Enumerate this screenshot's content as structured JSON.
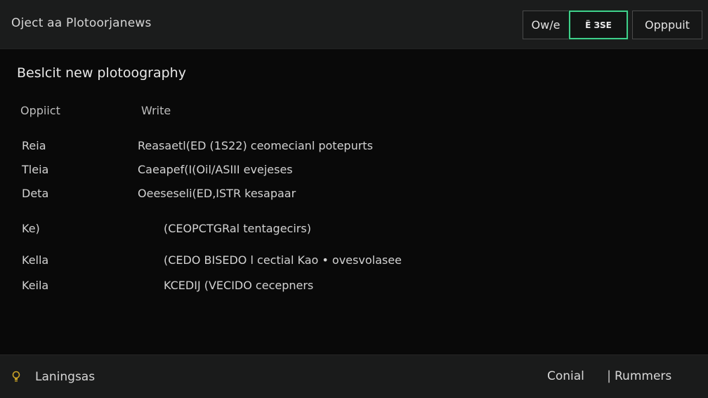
{
  "header": {
    "title": "Oject aa Plotoorjanews",
    "buttons": [
      "Ow/e",
      "Ё ЗSE",
      "Opppuit"
    ]
  },
  "main": {
    "heading": "Beslcit new plotoography",
    "columns": [
      "Oppiict",
      "Write"
    ],
    "rows": [
      {
        "label": "Reia",
        "value": "Reasaetl(ED (1S22)  ceomecianl  potepurts"
      },
      {
        "label": "Tleia",
        "value": "Caeapef(I(Oil/ASIII  evejeses"
      },
      {
        "label": "Deta",
        "value": "Oeeseseli(ED,ISTR  kesapaar"
      },
      {
        "label": "Ke)",
        "value": "(CEOPCTGRal  tentagecirs)"
      },
      {
        "label": "Kella",
        "value": "(CEDO BISEDO l  cectial  Kao  •  ovesvolasee"
      },
      {
        "label": "Keila",
        "value": "KCEDIJ (VECIDO  cecepners"
      }
    ]
  },
  "footer": {
    "label": "Laningsas",
    "links": [
      "Conial",
      "Rummers"
    ],
    "separator": "|",
    "icon": "lightbulb-icon",
    "icon_color": "#c9a227"
  },
  "colors": {
    "accent": "#3fcf8a",
    "header_bg": "#1b1c1c",
    "main_bg": "#090909",
    "footer_bg": "#1a1b1b"
  }
}
